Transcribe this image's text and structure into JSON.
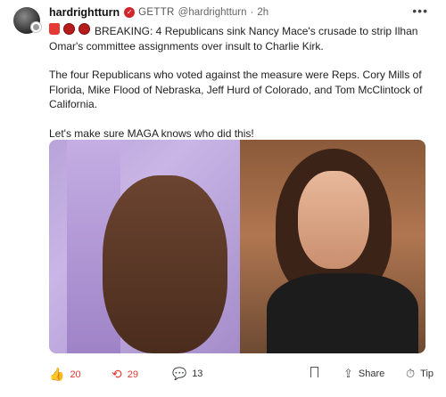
{
  "post": {
    "username": "hardrightturn",
    "platform": "GETTR",
    "handle": "@hardrightturn",
    "separator": "·",
    "time": "2h",
    "more_icon": "more-horizontal-icon",
    "text_line1": "BREAKING: 4 Republicans sink Nancy Mace's crusade to strip Ilhan Omar's committee assignments over insult to Charlie Kirk.",
    "text_para2": "The four Republicans who voted against the measure were Reps. Cory Mills of Florida, Mike Flood of Nebraska, Jeff Hurd of Colorado, and Tom McClintock of California.",
    "text_para3": "Let's make sure MAGA knows who did this!"
  },
  "actions": {
    "like_count": "20",
    "repost_count": "29",
    "comment_count": "13",
    "share_label": "Share",
    "tip_label": "Tip"
  },
  "colors": {
    "accent": "#e53935",
    "verified": "#d0262d"
  }
}
